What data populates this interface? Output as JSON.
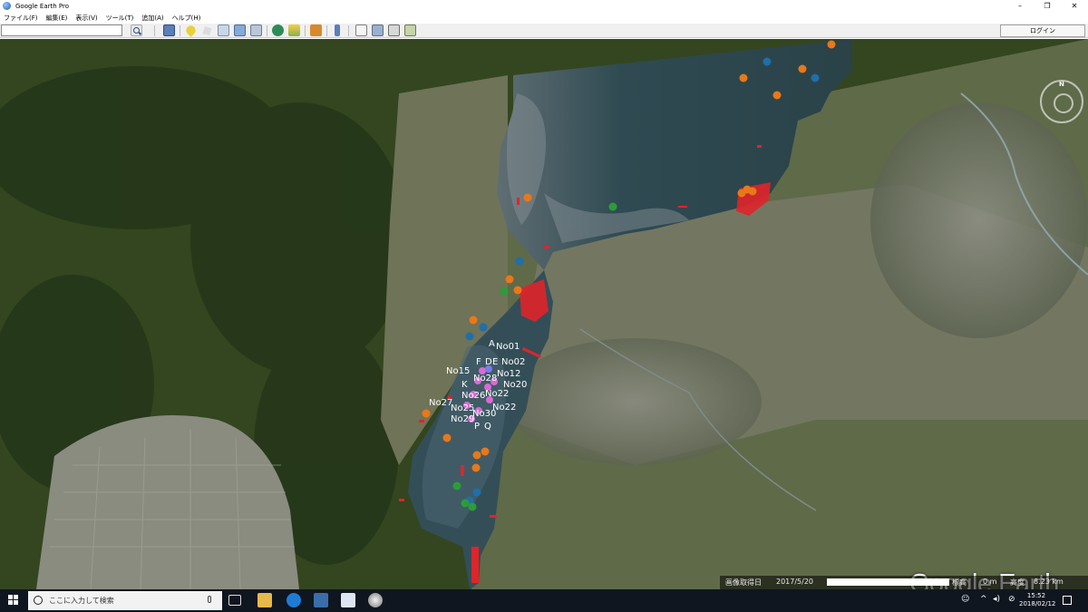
{
  "window": {
    "title": "Google Earth Pro",
    "controls": [
      "–",
      "❐",
      "✕"
    ]
  },
  "menu": [
    "ファイル(F)",
    "編集(E)",
    "表示(V)",
    "ツール(T)",
    "追加(A)",
    "ヘルプ(H)"
  ],
  "toolbar": {
    "search_value": "",
    "login_label": "ログイン",
    "icons": [
      "search-icon",
      "sidebar-icon",
      "placemark-icon",
      "polygon-icon",
      "path-icon",
      "overlay-icon",
      "tour-icon",
      "history-icon",
      "sunlight-icon",
      "planets-icon",
      "ruler-icon",
      "email-icon",
      "print-icon",
      "save-image-icon",
      "view-maps-icon"
    ]
  },
  "map": {
    "labels": [
      "A",
      "No01",
      "F",
      "D",
      "E",
      "No02",
      "No15",
      "No28",
      "No12",
      "K",
      "No20",
      "No26",
      "No22",
      "No27",
      "No25",
      "No30",
      "No22",
      "No29",
      "P",
      "Q"
    ],
    "logo": "Google Earth",
    "compass_label": "N",
    "status": {
      "imagery_date_label": "画像取得日",
      "imagery_date": "2017/5/20",
      "elevation_label": "標高",
      "elevation_value": "0 m",
      "eye_alt_label": "高度",
      "eye_alt_value": "8.23 km"
    },
    "colors": {
      "lake": "#3f5a63",
      "land": "#4a5a30",
      "marker_orange": "#e8781a",
      "marker_blue": "#1f6fa8",
      "marker_green": "#2c9c3a",
      "marker_pink": "#d86ad6",
      "track_red": "#e0242a"
    }
  },
  "taskbar": {
    "search_placeholder": "ここに入力して検索",
    "time": "15:52",
    "date": "2018/02/12",
    "apps": [
      "task-view-icon",
      "file-explorer-icon",
      "edge-icon",
      "store-icon",
      "notepad-icon",
      "google-earth-icon"
    ]
  }
}
